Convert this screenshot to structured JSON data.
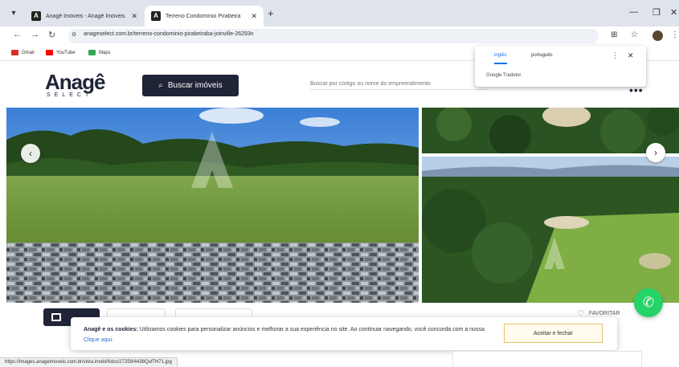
{
  "browser": {
    "tabs": [
      {
        "favicon": "A",
        "title": "Anagê Imóveis - Anagê Imóveis",
        "active": false
      },
      {
        "favicon": "A",
        "title": "Terreno Condomínio Pirabeira",
        "active": true
      }
    ],
    "new_tab_icon": "plus-icon",
    "url": "anageselect.com.br/terreno-condominio-pirabeiraba-joinville-26293n",
    "bookmarks": [
      {
        "label": "Gmail",
        "color": "#d93025"
      },
      {
        "label": "YouTube",
        "color": "#ff0000"
      },
      {
        "label": "Maps",
        "color": "#34a853"
      }
    ]
  },
  "translate_popup": {
    "tab_english": "inglês",
    "tab_portuguese": "português",
    "footer": "Google Tradutor"
  },
  "site": {
    "logo_main": "Anagê",
    "logo_sub": "SELECT",
    "search_button": "Buscar imóveis",
    "search_placeholder": "Buscar por código ou nome do empreendimento"
  },
  "property": {
    "favorite_label": "FAVORITAR"
  },
  "cookie": {
    "bold": "Anagê e os cookies:",
    "text": " Utilizamos cookies para personalizar anúncios e melhorar a sua experiência no site. Ao continuar navegando, você concorda com a nossa ",
    "link": "Clique aqui.",
    "button": "Aceitar e fechar"
  },
  "status_url": "https://images.anageimoveis.com.br/vista.imobi/fotos/27259/4438Quf7H71.jpg",
  "colors": {
    "brand_dark": "#1f2437",
    "whatsapp": "#25d366",
    "accent_gold": "#e8c26a"
  }
}
